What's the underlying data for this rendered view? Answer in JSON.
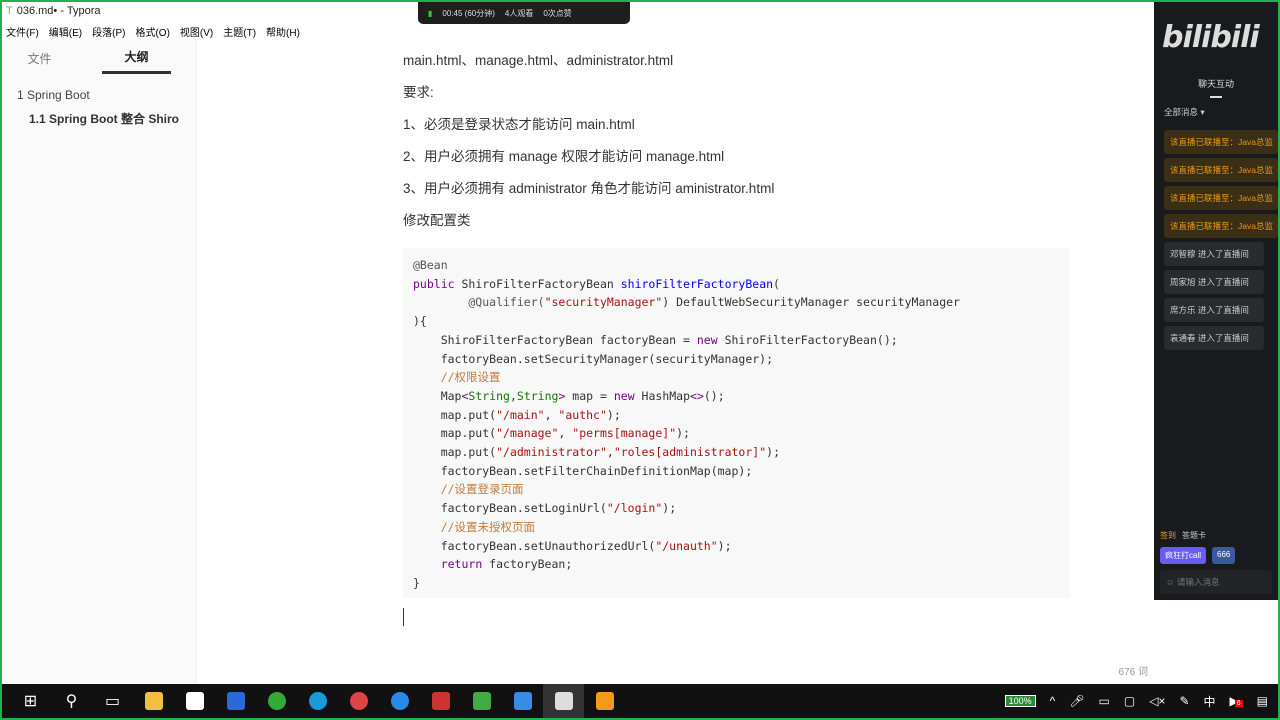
{
  "window": {
    "title": "036.md• - Typora"
  },
  "menu": [
    "文件(F)",
    "编辑(E)",
    "段落(P)",
    "格式(O)",
    "视图(V)",
    "主题(T)",
    "帮助(H)"
  ],
  "sidebar": {
    "tabs": [
      "文件",
      "大纲"
    ],
    "outline": [
      "1 Spring Boot",
      "1.1 Spring Boot 整合 Shiro"
    ]
  },
  "content": {
    "paragraphs": [
      "main.html、manage.html、administrator.html",
      "要求:",
      "1、必须是登录状态才能访问 main.html",
      "2、用户必须拥有 manage 权限才能访问 manage.html",
      "3、用户必须拥有 administrator 角色才能访问 aministrator.html",
      "修改配置类"
    ],
    "code": [
      [
        [
          "@Bean",
          "m"
        ]
      ],
      [
        [
          "public ",
          "k"
        ],
        [
          "ShiroFilterFactoryBean ",
          ""
        ],
        [
          "shiroFilterFactoryBean",
          "d"
        ],
        [
          "(",
          ""
        ]
      ],
      [
        [
          "        @Qualifier(",
          "m"
        ],
        [
          "\"securityManager\"",
          "s"
        ],
        [
          ") DefaultWebSecurityManager securityManager",
          ""
        ]
      ],
      [
        [
          "){",
          ""
        ]
      ],
      [
        [
          "    ShiroFilterFactoryBean factoryBean = ",
          ""
        ],
        [
          "new ",
          "k"
        ],
        [
          "ShiroFilterFactoryBean();",
          ""
        ]
      ],
      [
        [
          "    factoryBean.setSecurityManager(securityManager);",
          ""
        ]
      ],
      [
        [
          "    //权限设置",
          "c"
        ]
      ],
      [
        [
          "    Map",
          ""
        ],
        [
          "<",
          "k"
        ],
        [
          "String",
          "t"
        ],
        [
          ",",
          ""
        ],
        [
          "String",
          "t"
        ],
        [
          ">",
          "k"
        ],
        [
          " map = ",
          ""
        ],
        [
          "new ",
          "k"
        ],
        [
          "HashMap",
          ""
        ],
        [
          "<>",
          "k"
        ],
        [
          "();",
          ""
        ]
      ],
      [
        [
          "    map.put(",
          ""
        ],
        [
          "\"/main\"",
          "s"
        ],
        [
          ", ",
          ""
        ],
        [
          "\"authc\"",
          "s"
        ],
        [
          ");",
          ""
        ]
      ],
      [
        [
          "    map.put(",
          ""
        ],
        [
          "\"/manage\"",
          "s"
        ],
        [
          ", ",
          ""
        ],
        [
          "\"perms[manage]\"",
          "s"
        ],
        [
          ");",
          ""
        ]
      ],
      [
        [
          "    map.put(",
          ""
        ],
        [
          "\"/administrator\"",
          "s"
        ],
        [
          ",",
          ""
        ],
        [
          "\"roles[administrator]\"",
          "s"
        ],
        [
          ");",
          ""
        ]
      ],
      [
        [
          "    factoryBean.setFilterChainDefinitionMap(map);",
          ""
        ]
      ],
      [
        [
          "    //设置登录页面",
          "c"
        ]
      ],
      [
        [
          "    factoryBean.setLoginUrl(",
          ""
        ],
        [
          "\"/login\"",
          "s"
        ],
        [
          ");",
          ""
        ]
      ],
      [
        [
          "    //设置未授权页面",
          "c"
        ]
      ],
      [
        [
          "    factoryBean.setUnauthorizedUrl(",
          ""
        ],
        [
          "\"/unauth\"",
          "s"
        ],
        [
          ");",
          ""
        ]
      ],
      [
        [
          "    ",
          ""
        ],
        [
          "return ",
          "k"
        ],
        [
          "factoryBean;",
          ""
        ]
      ],
      [
        [
          "}",
          ""
        ]
      ]
    ]
  },
  "status": {
    "word_count": "676 词"
  },
  "live": {
    "time": "00:45 (60分钟)",
    "viewers": "4人观看",
    "likes": "0次点赞"
  },
  "bili": {
    "logo": "bilibili",
    "tab": "聊天互动",
    "filter": "全部消息 ▾",
    "messages": [
      {
        "text": "该直播已联播至：Java总监",
        "type": "sys"
      },
      {
        "text": "该直播已联播至：Java总监",
        "type": "sys"
      },
      {
        "text": "该直播已联播至：Java总监",
        "type": "sys"
      },
      {
        "text": "该直播已联播至：Java总监",
        "type": "sys"
      },
      {
        "text": "邓智穆 进入了直播间",
        "type": "u"
      },
      {
        "text": "周家旭 进入了直播间",
        "type": "u"
      },
      {
        "text": "席方乐 进入了直播间",
        "type": "u"
      },
      {
        "text": "袁通春 进入了直播间",
        "type": "u"
      }
    ],
    "checkin": "签到",
    "card": "答题卡",
    "call": "疯狂打call",
    "six": "666",
    "input_placeholder": "请输入消息"
  },
  "tray": {
    "battery": "100%",
    "ime": "中",
    "notif": "6"
  }
}
